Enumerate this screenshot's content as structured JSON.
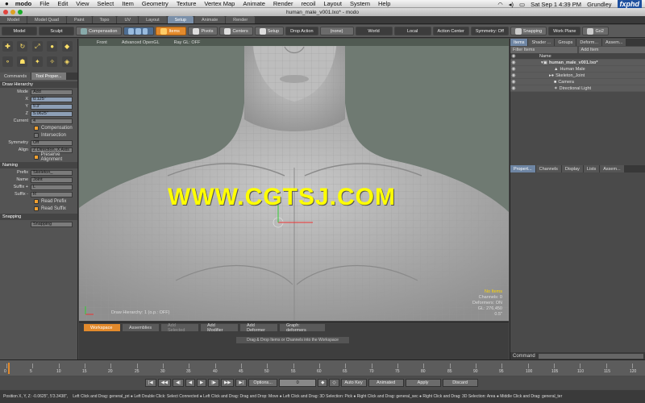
{
  "mac_menu": {
    "apple": "",
    "items": [
      "modo",
      "File",
      "Edit",
      "View",
      "Select",
      "Item",
      "Geometry",
      "Texture",
      "Vertex Map",
      "Animate",
      "Render",
      "recoil",
      "Layout",
      "System",
      "Help"
    ],
    "clock": "Sat Sep 1  4:39 PM",
    "user": "Grundley",
    "logo": "fxphd"
  },
  "window": {
    "title": "human_male_v001.lxo* - modo"
  },
  "layout_tabs": [
    "Model",
    "Model Quad",
    "Paint",
    "Topo",
    "UV",
    "Layout",
    "Setup",
    "Animate",
    "Render"
  ],
  "layout_tabs_active": "Setup",
  "toolbar": {
    "model": "Model",
    "sculpt": "Sculpt",
    "compensation": "Compensation",
    "items": "Items",
    "pivots": "Pivots",
    "centers": "Centers",
    "setup": "Setup",
    "drop_action_label": "Drop Action",
    "drop_action_value": "(none)",
    "world": "World",
    "local": "Local",
    "action_center": "Action Center",
    "symmetry": "Symmetry: Off",
    "snapping": "Snapping",
    "work_plane": "Work Plane",
    "go2": "Go2"
  },
  "left_panel": {
    "tabs": [
      "Commands",
      "Tool Proper..."
    ],
    "section_draw": "Draw Hierarchy",
    "mode_label": "Mode",
    "mode_value": "Add",
    "x_label": "X",
    "x_value": "0.125\"",
    "y_label": "Y",
    "y_value": "5'3\"",
    "z_label": "Z",
    "z_value": "5.0625\"",
    "current_label": "Current",
    "current_value": "4",
    "compensation": "Compensation",
    "intersection": "Intersection",
    "symmetry_label": "Symmetry",
    "symmetry_value": "Off",
    "align_label": "Align",
    "align_value": "Z Direction, X Axis",
    "preserve_alignment": "Preserve Alignment",
    "section_naming": "Naming",
    "prefix_label": "Prefix",
    "prefix_value": "Skeleton_",
    "name_label": "Name",
    "name_value": "Joint",
    "suffix_plus_label": "Suffix +",
    "suffix_plus_value": "L",
    "suffix_minus_label": "Suffix -",
    "suffix_minus_value": "R",
    "read_prefix": "Read Prefix",
    "read_suffix": "Read Suffix",
    "section_snapping": "Snapping",
    "snapping_value": "Snapping"
  },
  "viewport": {
    "header": [
      "Front",
      "Advanced OpenGL",
      "Ray GL: OFF"
    ],
    "watermark": "WWW.CGTSJ.COM",
    "draw_hierarchy_label": "Draw Hierarchy: 1 (o.p.: OFF)",
    "info": [
      "No Items",
      "Channels: 0",
      "Deformers: ON",
      "GL: 276,450",
      "0.5\""
    ]
  },
  "schematic": {
    "tabs": [
      "Workspace",
      "Assemblies",
      "Add Selected",
      "Add Modifier",
      "Add Deformer",
      "Graph: deformers"
    ],
    "hint": "Drag & Drop Items or Channels into the Workspace"
  },
  "right_panel": {
    "tabs": [
      "Items",
      "Shader ...",
      "Groups",
      "Deform...",
      "Assem..."
    ],
    "filter": "Filter Items",
    "add_item": "Add Item",
    "name_header": "Name",
    "items": [
      {
        "label": "human_male_v001.lxo*",
        "indent": 0
      },
      {
        "label": "Human Male",
        "indent": 1
      },
      {
        "label": "Skeleton_Joint",
        "indent": 1
      },
      {
        "label": "Camera",
        "indent": 1
      },
      {
        "label": "Directional Light",
        "indent": 1
      }
    ],
    "tabs2": [
      "Propert...",
      "Channels",
      "Display",
      "Lists",
      "Assem..."
    ],
    "command_label": "Command"
  },
  "timeline": {
    "ticks": [
      "0",
      "5",
      "10",
      "15",
      "20",
      "25",
      "30",
      "35",
      "40",
      "45",
      "50",
      "55",
      "60",
      "65",
      "70",
      "75",
      "80",
      "85",
      "90",
      "95",
      "100",
      "105",
      "110",
      "115",
      "120"
    ]
  },
  "transport": {
    "options": "Options...",
    "frame": "0",
    "auto_key": "Auto Key",
    "animated": "Animated",
    "apply": "Apply",
    "discard": "Discard"
  },
  "statusbar": {
    "position": "Position X, Y, Z:  -0.0625\", 5'3.3438\",",
    "hints": "Left Click and Drag: general_pri ●  Left Double Click: Select Connected ●  Left Click and Drag: Drag and Drop: Move ●  Left Click and Drag: 3D Selection: Pick ●  Right Click and Drag: general_sec ●  Right Click and Drag: 3D Selection: Area ●  Middle Click and Drag: general_ter"
  },
  "colors": {
    "accent": "#e28a2c",
    "selection": "#7e8fa4",
    "watermark": "#ffff00"
  }
}
